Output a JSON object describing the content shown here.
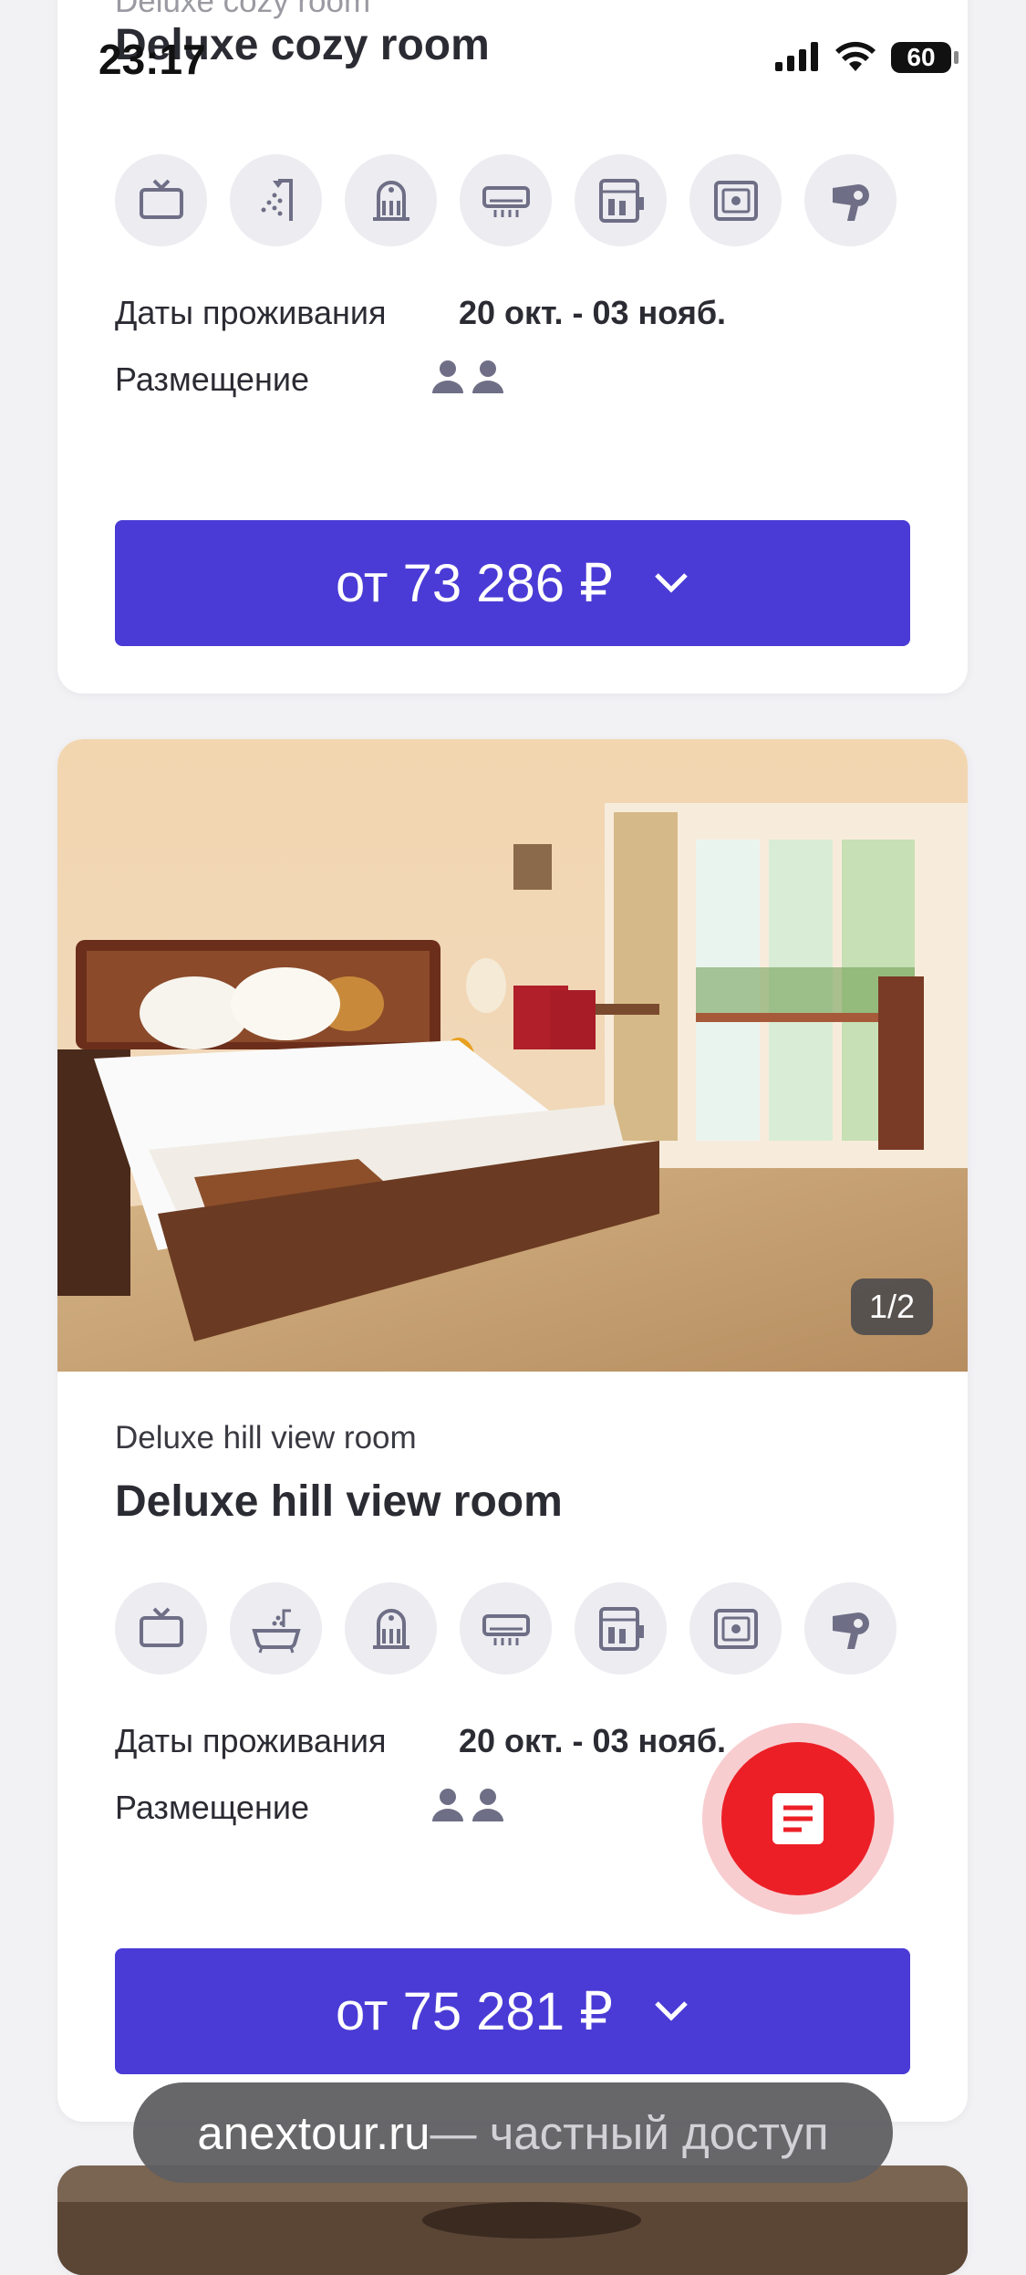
{
  "status_bar": {
    "time": "23:17",
    "battery": "60"
  },
  "cards": [
    {
      "subtitle": "Deluxe cozy room",
      "title": "Deluxe cozy room",
      "amenities": [
        "tv-icon",
        "shower-icon",
        "heater-icon",
        "air-conditioner-icon",
        "minibar-icon",
        "safe-icon",
        "hairdryer-icon"
      ],
      "dates_label": "Даты проживания",
      "dates_value": "20 окт. - 03 нояб.",
      "placement_label": "Размещение",
      "guests": 2,
      "price": "от 73 286 ₽"
    },
    {
      "photo_counter": "1/2",
      "subtitle": "Deluxe hill view room",
      "title": "Deluxe hill view room",
      "amenities": [
        "tv-icon",
        "bathtub-icon",
        "heater-icon",
        "air-conditioner-icon",
        "minibar-icon",
        "safe-icon",
        "hairdryer-icon"
      ],
      "dates_label": "Даты проживания",
      "dates_value": "20 окт. - 03 нояб.",
      "placement_label": "Размещение",
      "guests": 2,
      "price": "от 75 281 ₽"
    }
  ],
  "toast": {
    "domain": "anextour.ru",
    "rest": " — частный доступ"
  },
  "colors": {
    "accent": "#4a3bd6",
    "fab": "#ec1f26"
  }
}
